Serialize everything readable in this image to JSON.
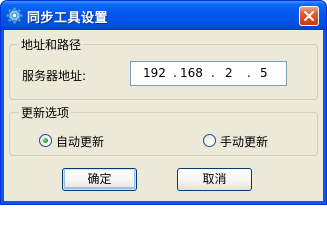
{
  "window": {
    "title": "同步工具设置"
  },
  "address_group": {
    "title": "地址和路径",
    "server_label": "服务器地址:",
    "ip_octets": [
      "192",
      "168",
      "2",
      "5"
    ],
    "ip_separator": "."
  },
  "update_group": {
    "title": "更新选项",
    "options": [
      {
        "label": "自动更新",
        "selected": true
      },
      {
        "label": "手动更新",
        "selected": false
      }
    ]
  },
  "buttons": {
    "ok_label": "确定",
    "cancel_label": "取消"
  },
  "icons": {
    "app": "gear-icon",
    "close": "close-icon"
  },
  "colors": {
    "titlebar": "#0058ee",
    "client_bg": "#ece9d8",
    "close_button": "#e2582f",
    "radio_selected": "#21a121"
  }
}
